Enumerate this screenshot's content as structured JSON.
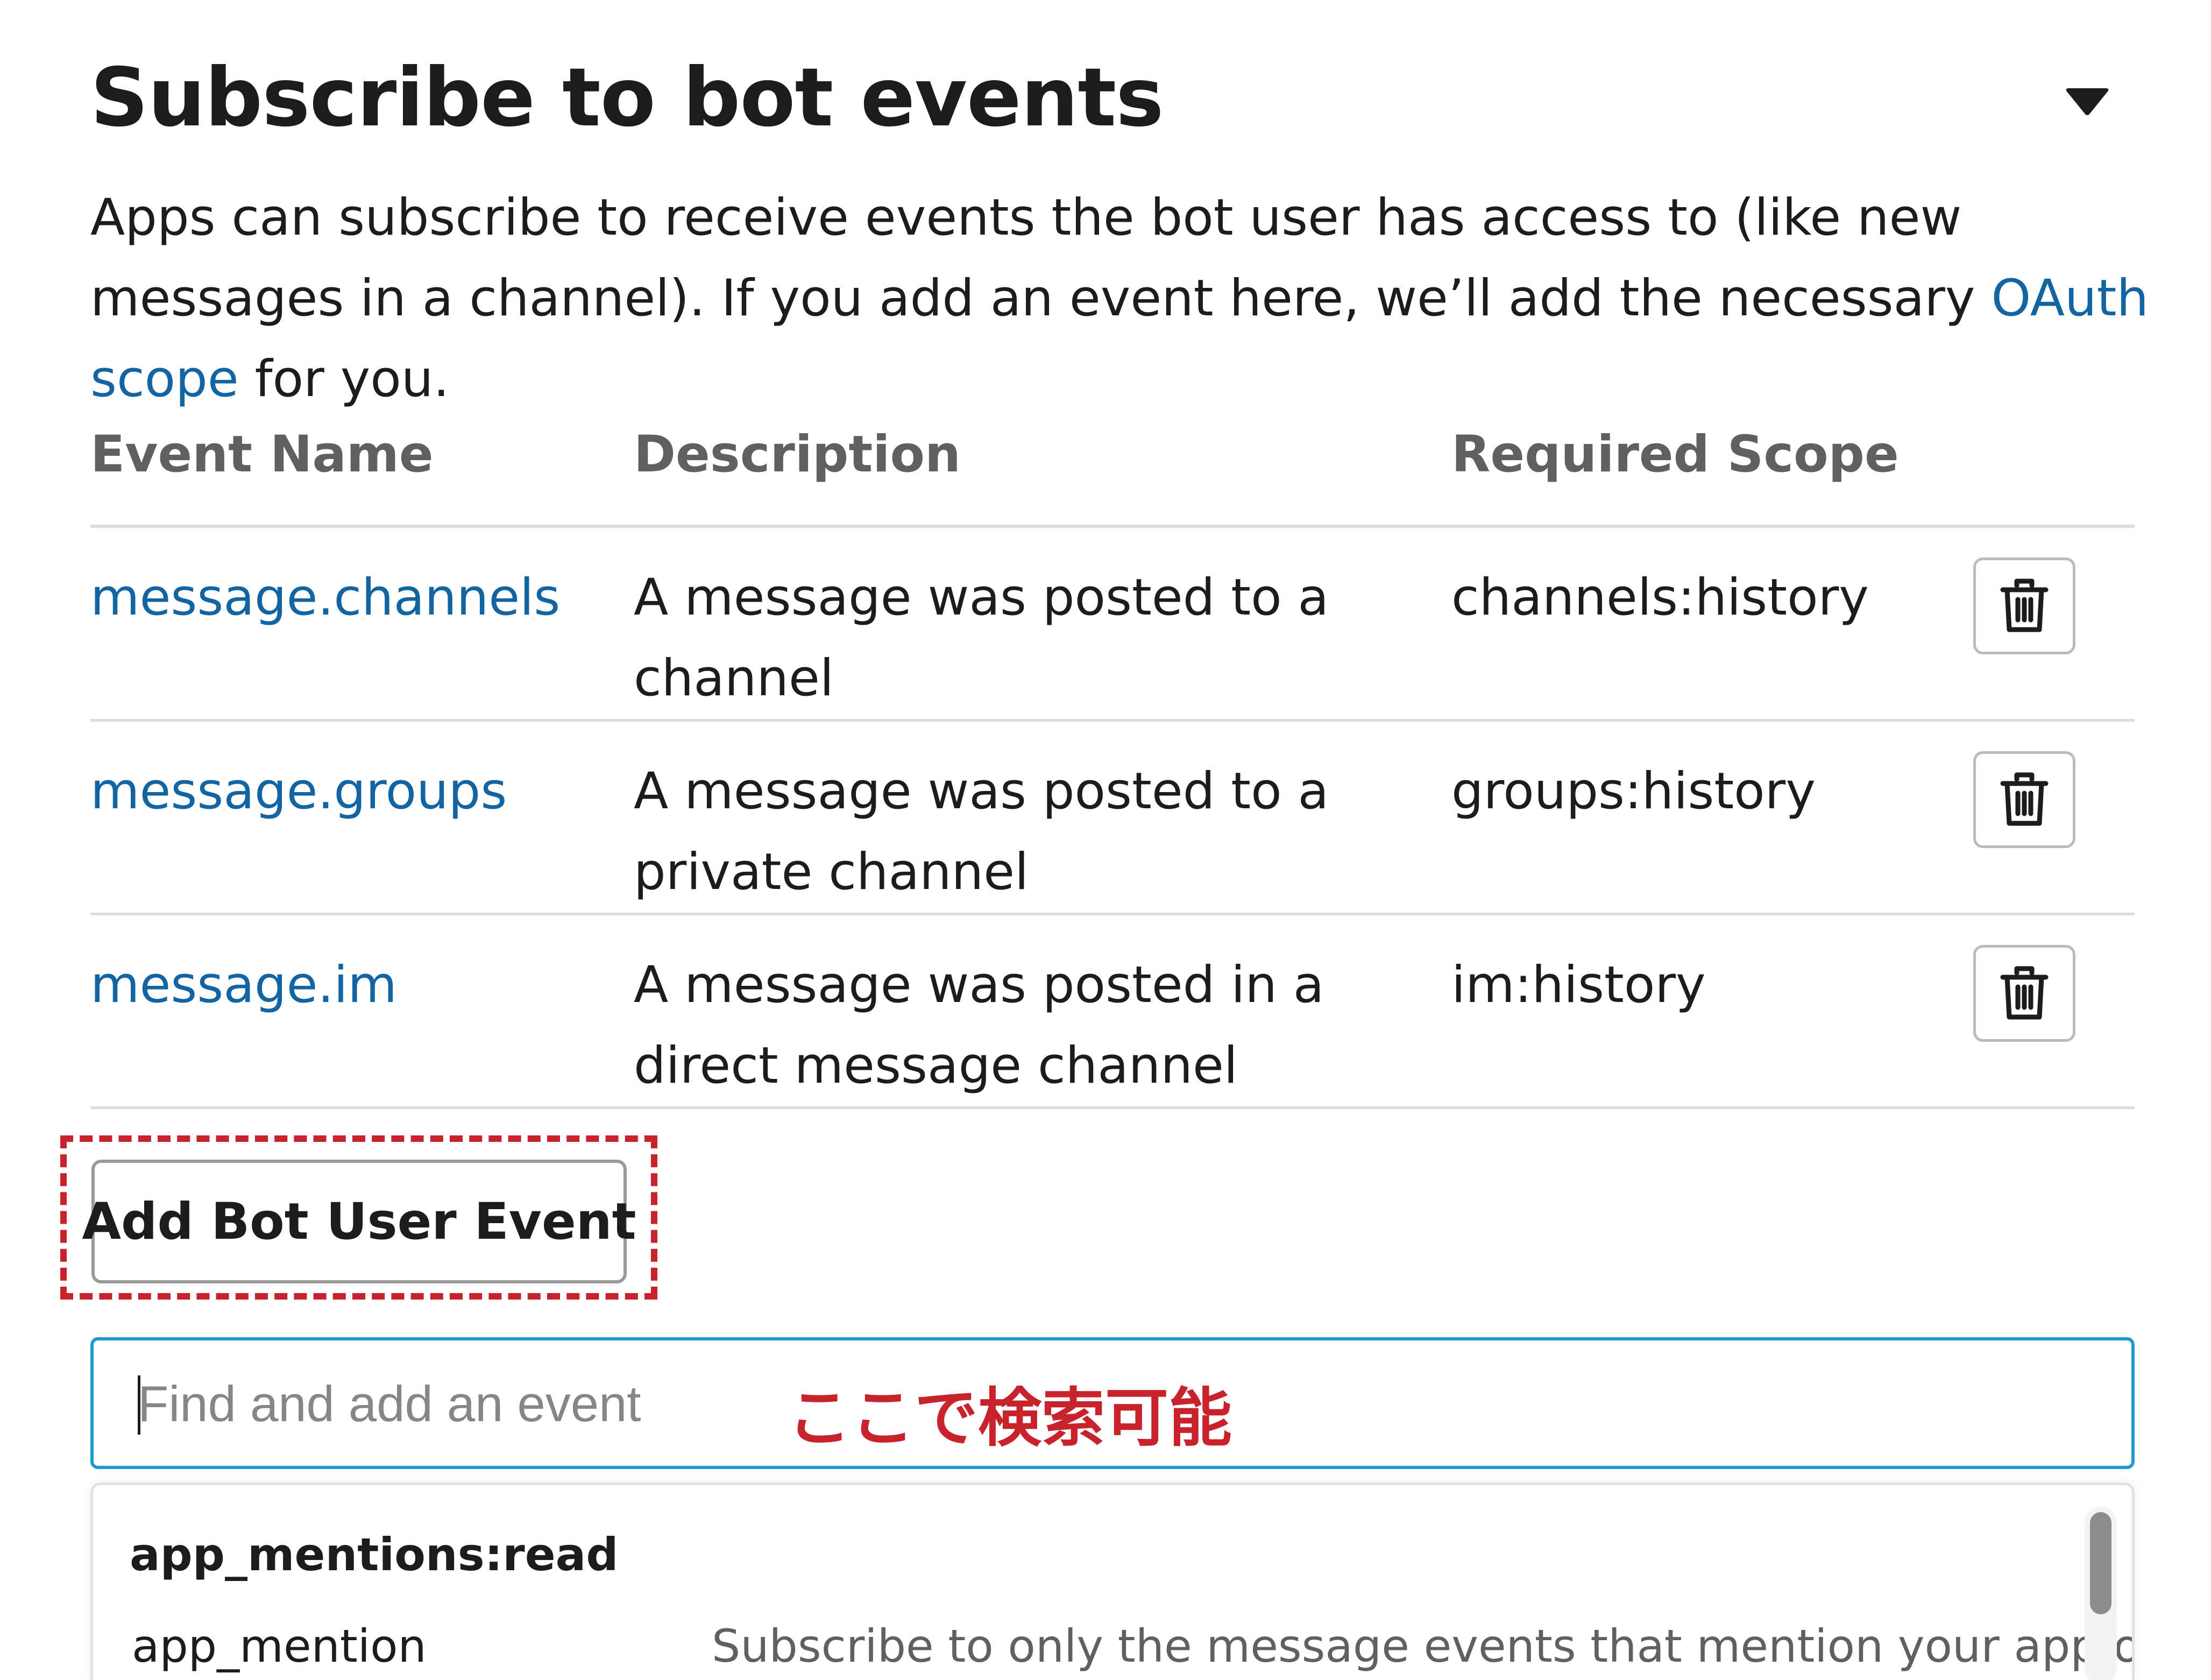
{
  "section": {
    "title": "Subscribe to bot events",
    "description_before_link": "Apps can subscribe to receive events the bot user has access to (like new messages in a channel). If you add an event here, we’ll add the necessary ",
    "description_link": "OAuth scope",
    "description_after_link": " for you."
  },
  "table": {
    "headers": [
      "Event Name",
      "Description",
      "Required Scope"
    ],
    "rows": [
      {
        "event": "message.channels",
        "description": "A message was posted to a channel",
        "scope": "channels:history"
      },
      {
        "event": "message.groups",
        "description": "A message was posted to a private channel",
        "scope": "groups:history"
      },
      {
        "event": "message.im",
        "description": "A message was posted in a direct message channel",
        "scope": "im:history"
      }
    ]
  },
  "add_button_label": "Add Bot User Event",
  "search": {
    "placeholder": "Find and add an event",
    "annotation": "ここで検索可能"
  },
  "dropdown": {
    "group_label": "app_mentions:read",
    "options": [
      {
        "name": "app_mention",
        "description": "Subscribe to only the message events that mention your app or bot"
      }
    ]
  },
  "icons": {
    "collapse": "caret-down-icon",
    "delete": "trash-icon"
  },
  "colors": {
    "link": "#1264a3",
    "annotation": "#c8232c",
    "focus_border": "#1d9bd1"
  }
}
